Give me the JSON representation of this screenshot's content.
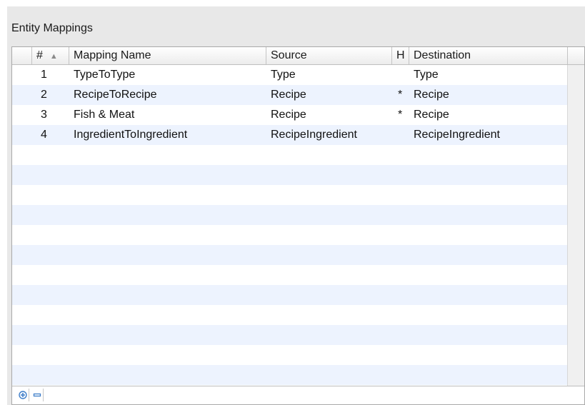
{
  "panel": {
    "title": "Entity Mappings"
  },
  "table": {
    "columns": {
      "num": "#",
      "name": "Mapping Name",
      "source": "Source",
      "h": "H",
      "destination": "Destination"
    },
    "sort_indicator": "▲",
    "rows": [
      {
        "num": "1",
        "name": "TypeToType",
        "source": "Type",
        "h": "",
        "destination": "Type"
      },
      {
        "num": "2",
        "name": "RecipeToRecipe",
        "source": "Recipe",
        "h": "*",
        "destination": "Recipe"
      },
      {
        "num": "3",
        "name": "Fish & Meat",
        "source": "Recipe",
        "h": "*",
        "destination": "Recipe"
      },
      {
        "num": "4",
        "name": "IngredientToIngredient",
        "source": "RecipeIngredient",
        "h": "",
        "destination": "RecipeIngredient"
      }
    ]
  },
  "toolbar": {
    "add_icon": "plus-icon",
    "remove_icon": "minus-icon"
  },
  "colors": {
    "alt_row": "#edf3fe",
    "panel_bg": "#e8e8e8",
    "icon_accent": "#3f7ec9"
  }
}
